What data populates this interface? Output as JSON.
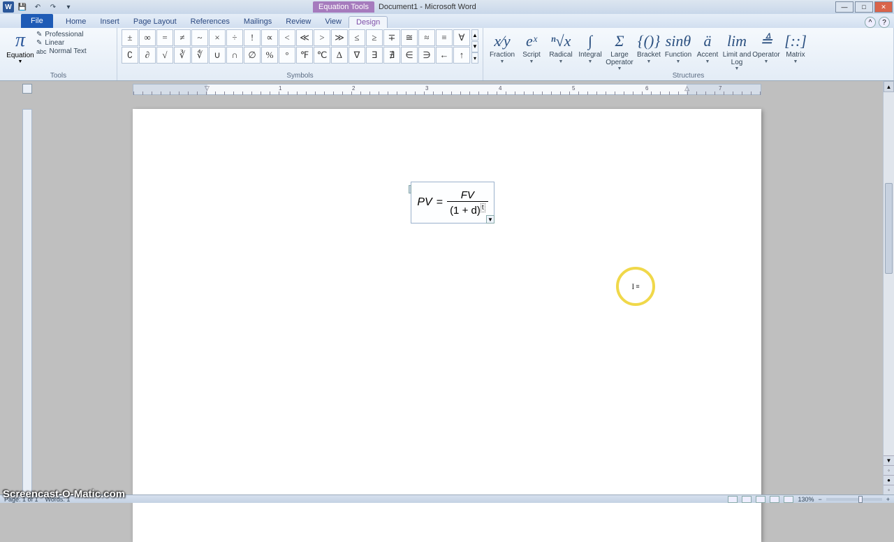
{
  "window": {
    "equation_tools_label": "Equation Tools",
    "title": "Document1 - Microsoft Word"
  },
  "tabs": {
    "file": "File",
    "items": [
      "Home",
      "Insert",
      "Page Layout",
      "References",
      "Mailings",
      "Review",
      "View"
    ],
    "contextual": "Design"
  },
  "ribbon": {
    "tools": {
      "equation": "Equation",
      "professional": "Professional",
      "linear": "Linear",
      "normal_text": "Normal Text",
      "group_label": "Tools"
    },
    "symbols": {
      "row1": [
        "±",
        "∞",
        "=",
        "≠",
        "~",
        "×",
        "÷",
        "!",
        "∝",
        "<",
        "≪",
        ">",
        "≫",
        "≤",
        "≥",
        "∓",
        "≅",
        "≈",
        "≡",
        "∀"
      ],
      "row2": [
        "∁",
        "∂",
        "√",
        "∛",
        "∜",
        "∪",
        "∩",
        "∅",
        "%",
        "°",
        "℉",
        "℃",
        "∆",
        "∇",
        "∃",
        "∄",
        "∈",
        "∋",
        "←",
        "↑"
      ],
      "group_label": "Symbols"
    },
    "structures": {
      "items": [
        {
          "label": "Fraction",
          "icon": "x⁄y"
        },
        {
          "label": "Script",
          "icon": "eˣ"
        },
        {
          "label": "Radical",
          "icon": "ⁿ√x"
        },
        {
          "label": "Integral",
          "icon": "∫"
        },
        {
          "label": "Large Operator",
          "icon": "Σ"
        },
        {
          "label": "Bracket",
          "icon": "{()}"
        },
        {
          "label": "Function",
          "icon": "sinθ"
        },
        {
          "label": "Accent",
          "icon": "ä"
        },
        {
          "label": "Limit and Log",
          "icon": "lim"
        },
        {
          "label": "Operator",
          "icon": "≜"
        },
        {
          "label": "Matrix",
          "icon": "[::]"
        }
      ],
      "group_label": "Structures"
    }
  },
  "ruler": {
    "numbers": [
      "1",
      "2",
      "3",
      "4",
      "5",
      "6",
      "7"
    ]
  },
  "equation": {
    "lhs": "PV",
    "eq": " = ",
    "numerator": "FV",
    "denominator": "(1 + d)",
    "exponent_placeholder": "t"
  },
  "status": {
    "page": "Page: 1 of 1",
    "words": "Words: 1",
    "zoom": "130%"
  },
  "watermark": "Screencast-O-Matic.com"
}
